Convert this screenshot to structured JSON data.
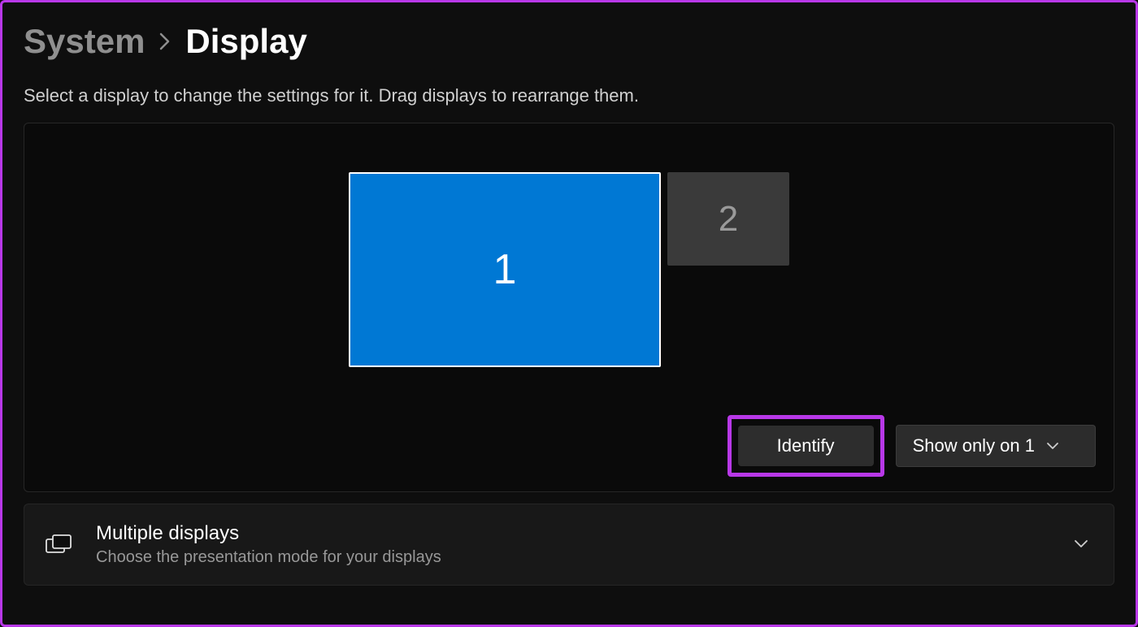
{
  "breadcrumb": {
    "parent": "System",
    "current": "Display"
  },
  "description": "Select a display to change the settings for it. Drag displays to rearrange them.",
  "monitors": {
    "primary": {
      "label": "1"
    },
    "secondary": {
      "label": "2"
    }
  },
  "actions": {
    "identify_label": "Identify",
    "mode_selected": "Show only on 1"
  },
  "settings": {
    "multiple_displays": {
      "title": "Multiple displays",
      "subtitle": "Choose the presentation mode for your displays"
    }
  }
}
